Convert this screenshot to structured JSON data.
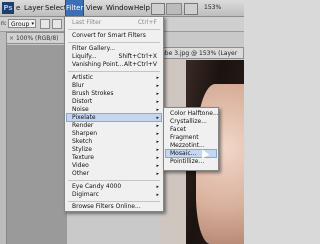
{
  "menubar": {
    "logo": "Ps",
    "items": [
      "e",
      "Layer",
      "Select",
      "Filter",
      "View",
      "Window",
      "Help"
    ],
    "zoom": "153%"
  },
  "options": {
    "label": "n:",
    "mode_select": "Group",
    "mode_caret": "▾"
  },
  "documents": {
    "left_tab": "100% (RGB/8)",
    "right_tab": "gbe 3.jpg @ 153% (Layer",
    "close_glyph": "×"
  },
  "filter_menu": {
    "items": [
      {
        "label": "Last Filter",
        "shortcut": "Ctrl+F",
        "disabled": true
      },
      {
        "label": "Convert for Smart Filters"
      },
      {
        "label": "Filter Gallery..."
      },
      {
        "label": "Liquify...",
        "shortcut": "Shift+Ctrl+X"
      },
      {
        "label": "Vanishing Point...",
        "shortcut": "Alt+Ctrl+V"
      },
      {
        "label": "Artistic",
        "submenu": true
      },
      {
        "label": "Blur",
        "submenu": true
      },
      {
        "label": "Brush Strokes",
        "submenu": true
      },
      {
        "label": "Distort",
        "submenu": true
      },
      {
        "label": "Noise",
        "submenu": true
      },
      {
        "label": "Pixelate",
        "submenu": true,
        "highlighted": true
      },
      {
        "label": "Render",
        "submenu": true
      },
      {
        "label": "Sharpen",
        "submenu": true
      },
      {
        "label": "Sketch",
        "submenu": true
      },
      {
        "label": "Stylize",
        "submenu": true
      },
      {
        "label": "Texture",
        "submenu": true
      },
      {
        "label": "Video",
        "submenu": true
      },
      {
        "label": "Other",
        "submenu": true
      },
      {
        "label": "Eye Candy 4000",
        "submenu": true
      },
      {
        "label": "Digimarc",
        "submenu": true
      },
      {
        "label": "Browse Filters Online..."
      }
    ],
    "arrow_glyph": "▸"
  },
  "pixelate_submenu": {
    "items": [
      {
        "label": "Color Halftone..."
      },
      {
        "label": "Crystallize..."
      },
      {
        "label": "Facet"
      },
      {
        "label": "Fragment"
      },
      {
        "label": "Mezzotint..."
      },
      {
        "label": "Mosaic...",
        "highlighted": true
      },
      {
        "label": "Pointillize..."
      }
    ]
  },
  "colors": {
    "active_menu": "#3d6fb4",
    "highlight": "#c5d6f0",
    "menu_bg": "#f0f0f0"
  }
}
